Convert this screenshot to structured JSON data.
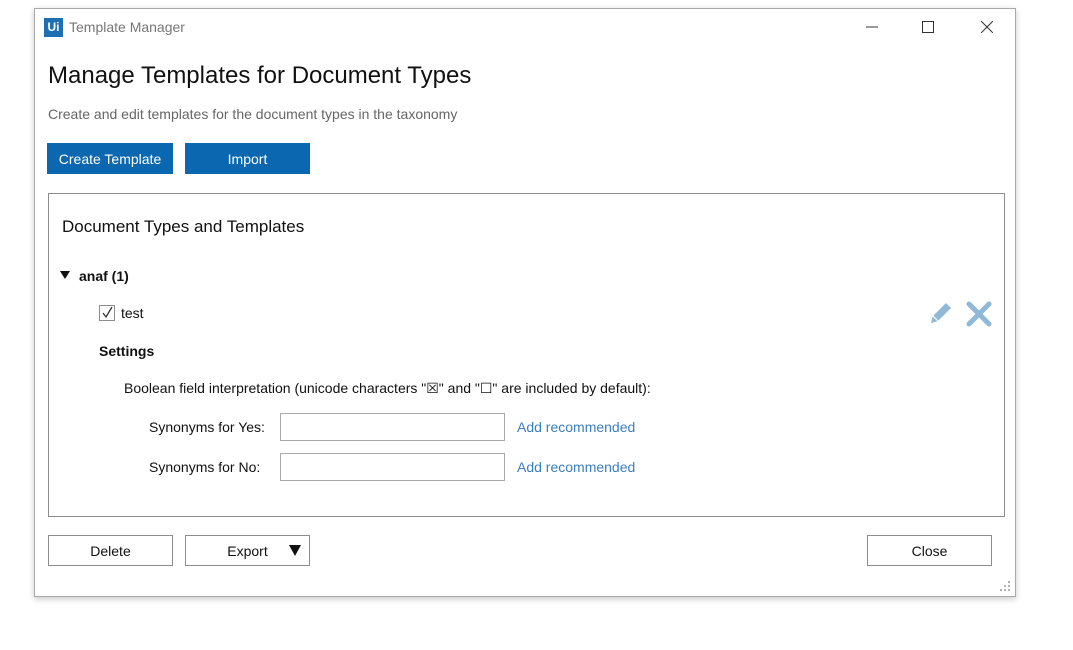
{
  "window": {
    "logo_text": "Ui",
    "title": "Template Manager",
    "controls": [
      "minimize-icon",
      "maximize-icon",
      "close-icon"
    ]
  },
  "header": {
    "title": "Manage Templates for Document Types",
    "subtitle": "Create and edit templates for the document types in the taxonomy"
  },
  "toolbar": {
    "create_label": "Create Template",
    "import_label": "Import"
  },
  "panel": {
    "title": "Document Types and Templates",
    "doc_type": {
      "label": "anaf (1)",
      "expanded": true
    },
    "template": {
      "name": "test",
      "checked": true,
      "actions": [
        "pencil-icon",
        "x-icon"
      ]
    },
    "settings": {
      "title": "Settings",
      "boolean_label": "Boolean field interpretation (unicode characters \"☒\" and \"☐\" are included by default):",
      "yes_label": "Synonyms for Yes:",
      "yes_value": "",
      "no_label": "Synonyms for No:",
      "no_value": "",
      "add_recommended": "Add recommended"
    }
  },
  "footer": {
    "delete_label": "Delete",
    "export_label": "Export",
    "close_label": "Close"
  },
  "colors": {
    "primary": "#0a67b0",
    "link": "#3a7fc1",
    "action_icon": "#8fb8d9"
  }
}
